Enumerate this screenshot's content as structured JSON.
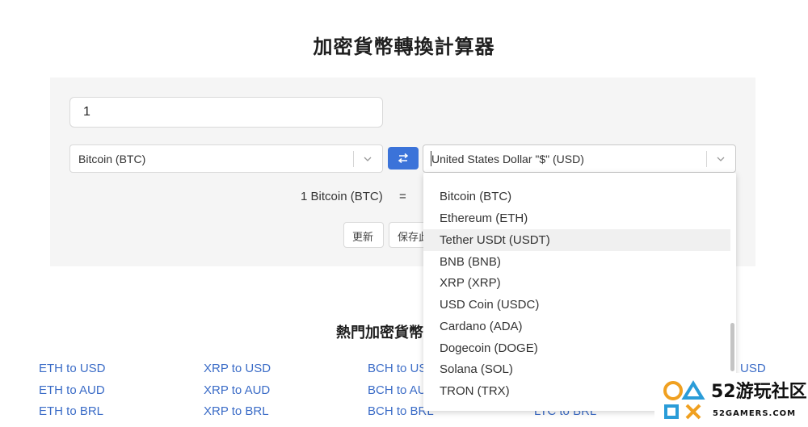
{
  "page": {
    "title": "加密貨幣轉換計算器"
  },
  "converter": {
    "amount": "1",
    "from_currency": "Bitcoin (BTC)",
    "to_currency": "United States Dollar \"$\" (USD)",
    "result_text": "1 Bitcoin (BTC)",
    "equals": "=",
    "refresh_label": "更新",
    "save_label": "保存此"
  },
  "dropdown": {
    "items": [
      "Bitcoin (BTC)",
      "Ethereum (ETH)",
      "Tether USDt (USDT)",
      "BNB (BNB)",
      "XRP (XRP)",
      "USD Coin (USDC)",
      "Cardano (ADA)",
      "Dogecoin (DOGE)",
      "Solana (SOL)",
      "TRON (TRX)"
    ],
    "hovered": "Tether USDt (USDT)"
  },
  "popular": {
    "title": "熱門加密貨幣",
    "columns": [
      [
        "ETH to USD",
        "ETH to AUD",
        "ETH to BRL"
      ],
      [
        "XRP to USD",
        "XRP to AUD",
        "XRP to BRL"
      ],
      [
        "BCH to USD",
        "BCH to AUD",
        "BCH to BRL"
      ],
      [
        "",
        "",
        "LTC to BRL"
      ],
      [
        "USD",
        "",
        ""
      ]
    ]
  },
  "watermark": {
    "text": "52游玩社区",
    "sub": "52GAMERS.COM"
  },
  "colors": {
    "accent": "#3b73d9",
    "link": "#3b6cc7",
    "panel": "#f5f5f5"
  }
}
